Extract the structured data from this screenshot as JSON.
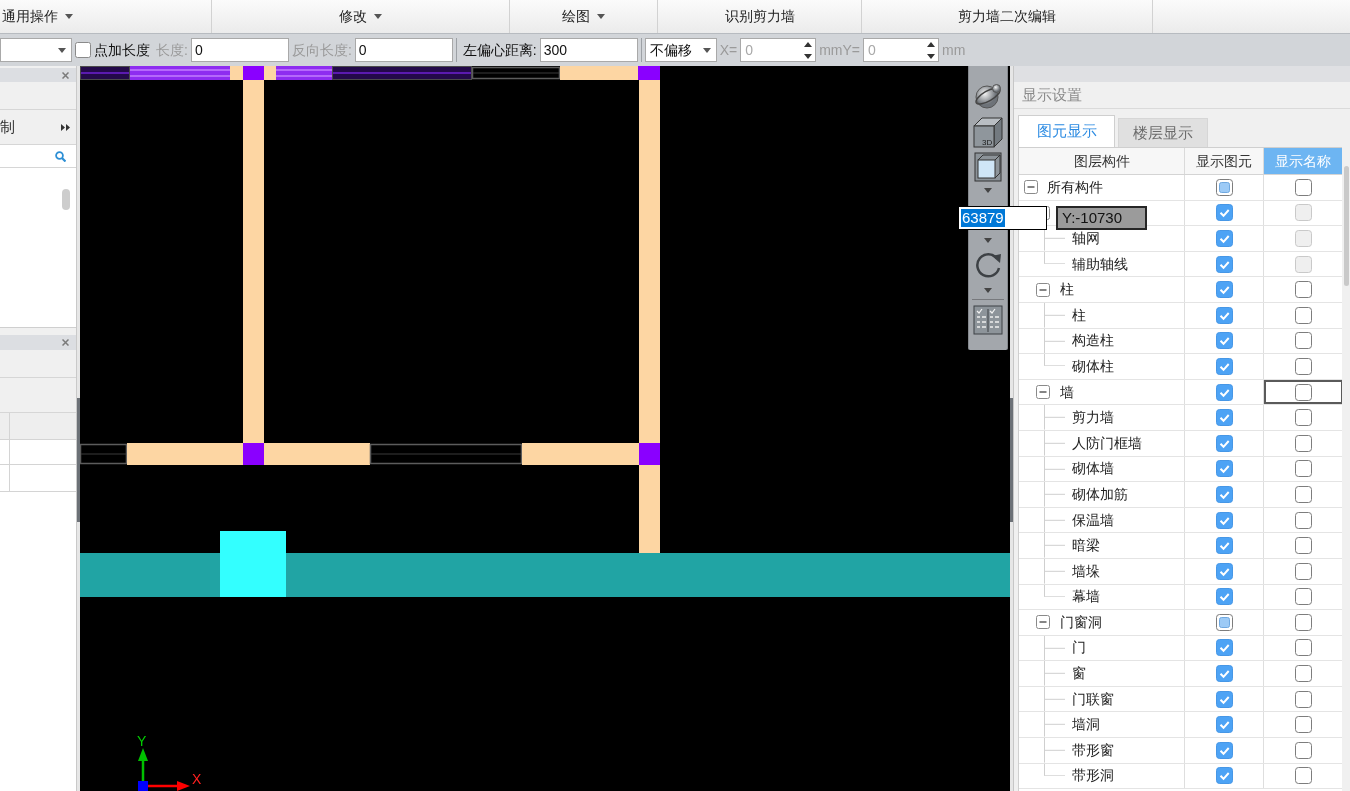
{
  "ribbon": {
    "groups": [
      {
        "label": "通用操作",
        "has_menu": true
      },
      {
        "label": "修改",
        "has_menu": true
      },
      {
        "label": "绘图",
        "has_menu": true
      },
      {
        "label": "识别剪力墙",
        "has_menu": false
      },
      {
        "label": "剪力墙二次编辑",
        "has_menu": false
      }
    ]
  },
  "property_bar": {
    "items": [
      {
        "kind": "dropdown"
      },
      {
        "kind": "checkbox",
        "label": "点加长度",
        "checked": false
      },
      {
        "kind": "label",
        "text": "长度:",
        "disabled": true
      },
      {
        "kind": "input",
        "value": "0",
        "disabled": false
      },
      {
        "kind": "label",
        "text": "反向长度:",
        "disabled": true
      },
      {
        "kind": "input",
        "value": "0",
        "disabled": false
      },
      {
        "kind": "separator"
      },
      {
        "kind": "label",
        "text": "左偏心距离:",
        "disabled": false
      },
      {
        "kind": "input",
        "value": "300",
        "disabled": false
      },
      {
        "kind": "separator"
      },
      {
        "kind": "dropdown",
        "value": "不偏移"
      },
      {
        "kind": "label",
        "text": "X=",
        "disabled": true
      },
      {
        "kind": "spinner",
        "value": "0",
        "disabled": true
      },
      {
        "kind": "label",
        "text": "mmY=",
        "disabled": true
      },
      {
        "kind": "spinner",
        "value": "0",
        "disabled": true
      },
      {
        "kind": "label",
        "text": "mm",
        "disabled": true
      }
    ]
  },
  "left_panel": {
    "section_label": "制"
  },
  "canvas": {
    "axis_labels": {
      "y": "Y",
      "x": "X"
    }
  },
  "view_toolbar": {
    "cube_label": "3D"
  },
  "coordinate_input": {
    "x_value": "63879",
    "x_selected": true,
    "y_text": "Y:-10730"
  },
  "display_settings": {
    "title": "显示设置",
    "tabs": [
      {
        "label": "图元显示",
        "selected": true
      },
      {
        "label": "楼层显示",
        "selected": false
      }
    ],
    "columns": [
      {
        "label": "图层构件",
        "selected": false
      },
      {
        "label": "显示图元",
        "selected": false
      },
      {
        "label": "显示名称",
        "selected": true
      }
    ],
    "tree": [
      {
        "label": "所有构件",
        "expanded": true,
        "show_checked": false,
        "show_partial": true,
        "show_name": false,
        "name_disabled": false,
        "focused": false,
        "children": [
          {
            "expanded": true,
            "show_checked": true,
            "show_partial": false,
            "show_name": false,
            "name_disabled": true,
            "focused": false,
            "children": [
              {
                "label": "轴网",
                "show_checked": true,
                "show_partial": false,
                "show_name": false,
                "name_disabled": true,
                "focused": false
              },
              {
                "label": "辅助轴线",
                "show_checked": true,
                "show_partial": false,
                "show_name": false,
                "name_disabled": true,
                "focused": false
              }
            ]
          },
          {
            "label": "柱",
            "expanded": true,
            "show_checked": true,
            "show_partial": false,
            "show_name": false,
            "name_disabled": false,
            "focused": false,
            "children": [
              {
                "label": "柱",
                "show_checked": true,
                "show_partial": false,
                "show_name": false,
                "name_disabled": false,
                "focused": false
              },
              {
                "label": "构造柱",
                "show_checked": true,
                "show_partial": false,
                "show_name": false,
                "name_disabled": false,
                "focused": false
              },
              {
                "label": "砌体柱",
                "show_checked": true,
                "show_partial": false,
                "show_name": false,
                "name_disabled": false,
                "focused": false
              }
            ]
          },
          {
            "label": "墙",
            "expanded": true,
            "show_checked": true,
            "show_partial": false,
            "show_name": false,
            "name_disabled": false,
            "focused": true,
            "children": [
              {
                "label": "剪力墙",
                "show_checked": true,
                "show_partial": false,
                "show_name": false,
                "name_disabled": false,
                "focused": false
              },
              {
                "label": "人防门框墙",
                "show_checked": true,
                "show_partial": false,
                "show_name": false,
                "name_disabled": false,
                "focused": false
              },
              {
                "label": "砌体墙",
                "show_checked": true,
                "show_partial": false,
                "show_name": false,
                "name_disabled": false,
                "focused": false
              },
              {
                "label": "砌体加筋",
                "show_checked": true,
                "show_partial": false,
                "show_name": false,
                "name_disabled": false,
                "focused": false
              },
              {
                "label": "保温墙",
                "show_checked": true,
                "show_partial": false,
                "show_name": false,
                "name_disabled": false,
                "focused": false
              },
              {
                "label": "暗梁",
                "show_checked": true,
                "show_partial": false,
                "show_name": false,
                "name_disabled": false,
                "focused": false
              },
              {
                "label": "墙垛",
                "show_checked": true,
                "show_partial": false,
                "show_name": false,
                "name_disabled": false,
                "focused": false
              },
              {
                "label": "幕墙",
                "show_checked": true,
                "show_partial": false,
                "show_name": false,
                "name_disabled": false,
                "focused": false
              }
            ]
          },
          {
            "label": "门窗洞",
            "expanded": true,
            "show_checked": false,
            "show_partial": true,
            "show_name": false,
            "name_disabled": false,
            "focused": false,
            "children": [
              {
                "label": "门",
                "show_checked": true,
                "show_partial": false,
                "show_name": false,
                "name_disabled": false,
                "focused": false
              },
              {
                "label": "窗",
                "show_checked": true,
                "show_partial": false,
                "show_name": false,
                "name_disabled": false,
                "focused": false
              },
              {
                "label": "门联窗",
                "show_checked": true,
                "show_partial": false,
                "show_name": false,
                "name_disabled": false,
                "focused": false
              },
              {
                "label": "墙洞",
                "show_checked": true,
                "show_partial": false,
                "show_name": false,
                "name_disabled": false,
                "focused": false
              },
              {
                "label": "带形窗",
                "show_checked": true,
                "show_partial": false,
                "show_name": false,
                "name_disabled": false,
                "focused": false
              },
              {
                "label": "带形洞",
                "show_checked": true,
                "show_partial": false,
                "show_name": false,
                "name_disabled": false,
                "focused": false
              }
            ]
          }
        ]
      }
    ]
  }
}
